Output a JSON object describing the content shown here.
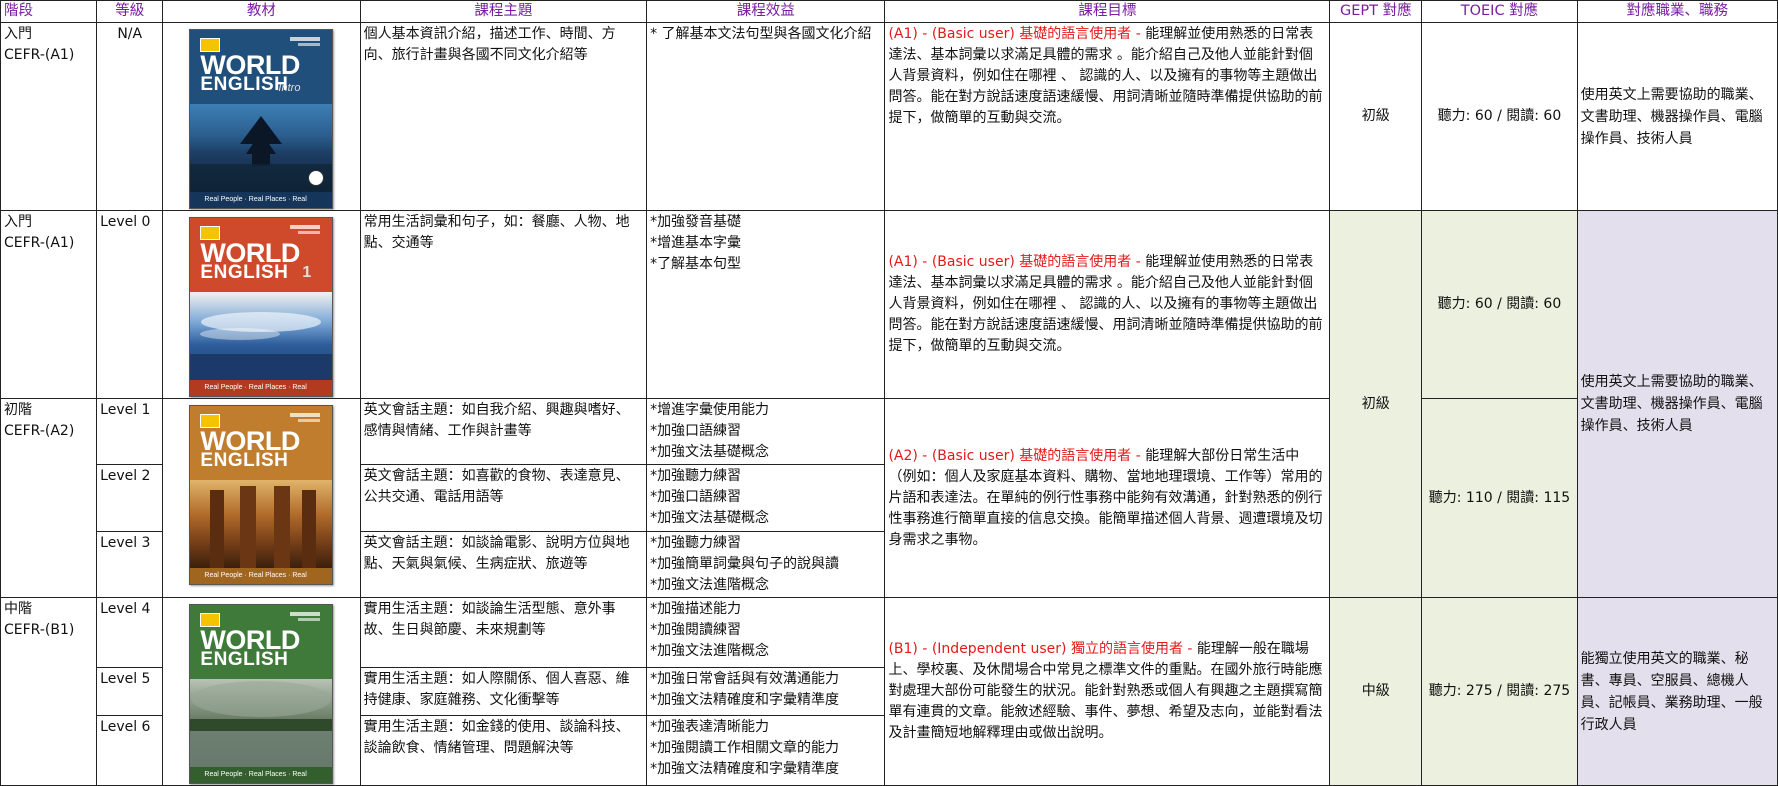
{
  "headers": {
    "stage": "階段",
    "level": "等級",
    "textbook": "教材",
    "topic": "課程主題",
    "benefit": "課程效益",
    "goal": "課程目標",
    "gept": "GEPT 對應",
    "toeic": "TOEIC 對應",
    "jobs": "對應職業、職務"
  },
  "colors": {
    "header_text": "#7a1fa0",
    "goal_red": "#e31a1a",
    "green_fill": "#ebf1de",
    "lavender_fill": "#e4dfec"
  },
  "covers": {
    "intro": {
      "t1": "WORLD",
      "t2": "ENGLISH",
      "sub": "Intro",
      "foot": "Real People · Real Places · Real Language"
    },
    "b1": {
      "t1": "WORLD",
      "t2": "ENGLISH",
      "sub": "1",
      "foot": "Real People · Real Places · Real Language"
    },
    "b2": {
      "t1": "WORLD",
      "t2": "ENGLISH",
      "sub": "",
      "foot": "Real People · Real Places · Real Language"
    },
    "b3": {
      "t1": "WORLD",
      "t2": "ENGLISH",
      "sub": "",
      "foot": "Real People · Real Places · Real Language"
    }
  },
  "rows": {
    "intro": {
      "stage_l1": "入門",
      "stage_l2": "CEFR-(A1)",
      "level": "N/A",
      "topic": "個人基本資訊介紹，描述工作、時間、方向、旅行計畫與各國不同文化介紹等",
      "benefit": "* 了解基本文法句型與各國文化介紹",
      "goal_red": "(A1) -  (Basic user) 基礎的語言使用者 -",
      "goal": " 能理解並使用熟悉的日常表達法、基本詞彙以求滿足具體的需求 。能介紹自己及他人並能針對個人背景資料，例如住在哪裡 、 認識的人、以及擁有的事物等主題做出問答。能在對方說話速度語速緩慢、用詞清晰並隨時準備提供協助的前提下，做簡單的互動與交流。",
      "gept": "初級",
      "toeic": "聽力: 60 / 閱讀: 60",
      "jobs": "使用英文上需要協助的職業、文書助理、機器操作員、電腦操作員、技術人員"
    },
    "level0": {
      "stage_l1": "入門",
      "stage_l2": "CEFR-(A1)",
      "level": "Level 0",
      "topic": "常用生活詞彙和句子，如：餐廳、人物、地點、交通等",
      "benefit_1": "*加強發音基礎",
      "benefit_2": "*增進基本字彙",
      "benefit_3": "*了解基本句型",
      "goal_red": "(A1) -  (Basic user) 基礎的語言使用者 -",
      "goal": " 能理解並使用熟悉的日常表達法、基本詞彙以求滿足具體的需求 。能介紹自己及他人並能針對個人背景資料，例如住在哪裡 、 認識的人、以及擁有的事物等主題做出問答。能在對方說話速度語速緩慢、用詞清晰並隨時準備提供協助的前提下，做簡單的互動與交流。",
      "toeic": "聽力: 60 / 閱讀: 60"
    },
    "a2": {
      "stage_l1": "初階",
      "stage_l2": "CEFR-(A2)",
      "goal_red": "(A2) - (Basic user) 基礎的語言使用者 -",
      "goal": " 能理解大部份日常生活中（例如：個人及家庭基本資料、購物、當地地理環境、工作等）常用的片語和表達法。在單純的例行性事務中能夠有效溝通，針對熟悉的例行性事務進行簡單直接的信息交換。能簡單描述個人背景、週遭環境及切身需求之事物。",
      "toeic": "聽力: 110 / 閱讀: 115",
      "level1": {
        "level": "Level 1",
        "topic": "英文會話主題：如自我介紹、興趣與嗜好、感情與情緒、工作與計畫等",
        "benefit_1": "*增進字彙使用能力",
        "benefit_2": "*加強口語練習",
        "benefit_3": "*加強文法基礎概念"
      },
      "level2": {
        "level": "Level 2",
        "topic": "英文會話主題：如喜歡的食物、表達意見、公共交通、電話用語等",
        "benefit_1": "*加強聽力練習",
        "benefit_2": "*加強口語練習",
        "benefit_3": "*加強文法基礎概念"
      },
      "level3": {
        "level": "Level 3",
        "topic": "英文會話主題：如談論電影、說明方位與地點、天氣與氣候、生病症狀、旅遊等",
        "benefit_1": "*加強聽力練習",
        "benefit_2": "*加強簡單詞彙與句子的說與讀",
        "benefit_3": "*加強文法進階概念"
      }
    },
    "a1_shared": {
      "gept": "初級",
      "jobs": "使用英文上需要協助的職業、文書助理、機器操作員、電腦操作員、技術人員"
    },
    "b1": {
      "stage_l1": "中階",
      "stage_l2": "CEFR-(B1)",
      "goal_red": "(B1) - (Independent user) 獨立的語言使用者 -",
      "goal": " 能理解一般在職場上、學校裏、及休閒場合中常見之標準文件的重點。在國外旅行時能應對處理大部份可能發生的狀況。能針對熟悉或個人有興趣之主題撰寫簡單有連貫的文章。能敘述經驗、事件、夢想、希望及志向，並能對看法及計畫簡短地解釋理由或做出說明。",
      "gept": "中級",
      "toeic": "聽力: 275 / 閱讀: 275",
      "jobs": "能獨立使用英文的職業、秘書、專員、空服員、總機人員、記帳員、業務助理、一般行政人員",
      "level4": {
        "level": "Level 4",
        "topic": "實用生活主題：如談論生活型態、意外事故、生日與節慶、未來規劃等",
        "benefit_1": "*加強描述能力",
        "benefit_2": "*加強閱讀練習",
        "benefit_3": "*加強文法進階概念"
      },
      "level5": {
        "level": "Level 5",
        "topic": "實用生活主題：如人際關係、個人喜惡、維持健康、家庭雜務、文化衝擊等",
        "benefit_1": "*加強日常會話與有效溝通能力",
        "benefit_2": "*加強文法精確度和字彙精準度"
      },
      "level6": {
        "level": "Level 6",
        "topic": "實用生活主題：如金錢的使用、談論科技、談論飲食、情緒管理、問題解決等",
        "benefit_1": "*加強表達清晰能力",
        "benefit_2": "*加強閱讀工作相關文章的能力",
        "benefit_3": "*加強文法精確度和字彙精準度"
      }
    }
  }
}
